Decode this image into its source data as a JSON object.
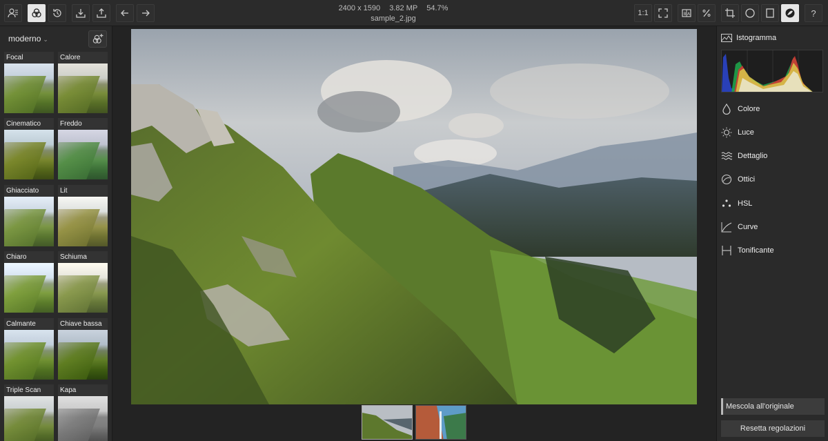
{
  "toolbar": {
    "left_buttons": [
      "profile-menu-icon",
      "presets-icon",
      "history-icon",
      "import-icon",
      "export-icon",
      "undo-icon",
      "redo-icon"
    ],
    "right_buttons": {
      "zoom_1_1": "1:1",
      "fit": "fit-screen-icon",
      "compare": "compare-icon",
      "percent": "percent-icon",
      "crop": "crop-icon",
      "circle": "circle-icon",
      "frame": "frame-icon",
      "edit": "edit-tone-icon",
      "help": "?"
    }
  },
  "file": {
    "dimensions": "2400 x 1590",
    "megapixels": "3.82 MP",
    "zoom": "54.7%",
    "name": "sample_2.jpg"
  },
  "presets": {
    "category": "moderno",
    "items": [
      {
        "label": "Focal"
      },
      {
        "label": "Calore"
      },
      {
        "label": "Cinematico"
      },
      {
        "label": "Freddo"
      },
      {
        "label": "Ghiacciato"
      },
      {
        "label": "Lit"
      },
      {
        "label": "Chiaro"
      },
      {
        "label": "Schiuma"
      },
      {
        "label": "Calmante"
      },
      {
        "label": "Chiave bassa"
      },
      {
        "label": "Triple Scan"
      },
      {
        "label": "Kapa"
      }
    ]
  },
  "right_panel": {
    "histogram_label": "Istogramma",
    "tools": [
      {
        "label": "Colore",
        "icon": "drop-icon"
      },
      {
        "label": "Luce",
        "icon": "sun-icon"
      },
      {
        "label": "Dettaglio",
        "icon": "waves-icon"
      },
      {
        "label": "Ottici",
        "icon": "lens-icon"
      },
      {
        "label": "HSL",
        "icon": "dots-icon"
      },
      {
        "label": "Curve",
        "icon": "curve-icon"
      },
      {
        "label": "Tonificante",
        "icon": "toning-icon"
      }
    ],
    "mix_label": "Mescola all'originale",
    "reset_label": "Resetta regolazioni"
  }
}
